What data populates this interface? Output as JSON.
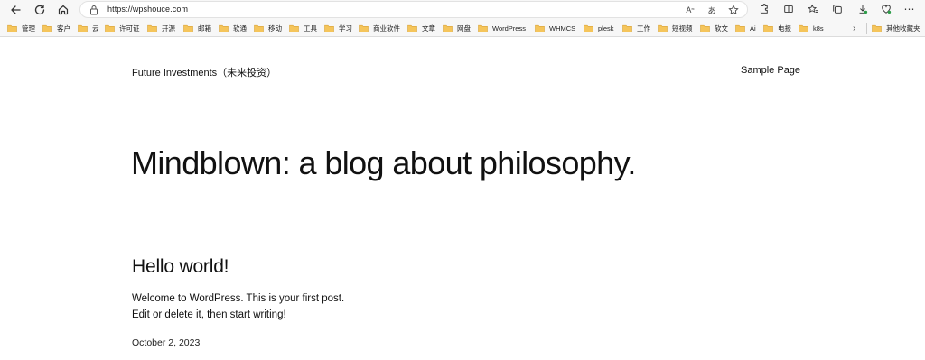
{
  "browser": {
    "url": "https://wpshouce.com",
    "reader_label": "A",
    "translate_label": "あ",
    "bookmarks": [
      {
        "label": "管理"
      },
      {
        "label": "客户"
      },
      {
        "label": "云"
      },
      {
        "label": "许可证"
      },
      {
        "label": "开源"
      },
      {
        "label": "邮箱"
      },
      {
        "label": "软通"
      },
      {
        "label": "移动"
      },
      {
        "label": "工具"
      },
      {
        "label": "学习"
      },
      {
        "label": "商业软件"
      },
      {
        "label": "文章"
      },
      {
        "label": "网盘"
      },
      {
        "label": "WordPress"
      },
      {
        "label": "WHMCS"
      },
      {
        "label": "plesk"
      },
      {
        "label": "工作"
      },
      {
        "label": "短视频"
      },
      {
        "label": "软文"
      },
      {
        "label": "Ai"
      },
      {
        "label": "电报"
      },
      {
        "label": "k8s"
      }
    ],
    "other_bookmarks": "其他收藏夹"
  },
  "site": {
    "title": "Future Investments（未来投资）",
    "nav": {
      "sample_page": "Sample Page"
    },
    "headline": "Mindblown: a blog about philosophy."
  },
  "post": {
    "title": "Hello world!",
    "excerpt_line1": "Welcome to WordPress. This is your first post.",
    "excerpt_line2": "Edit or delete it, then start writing!",
    "date": "October 2, 2023"
  }
}
